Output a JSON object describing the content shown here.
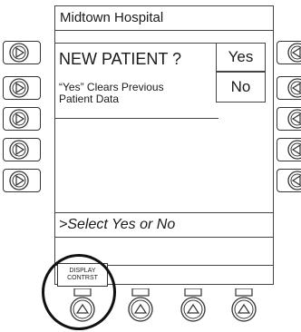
{
  "header": {
    "hospital": "Midtown Hospital"
  },
  "dialog": {
    "title": "NEW PATIENT ?",
    "message": "“Yes” Clears Previous Patient Data",
    "yes_label": "Yes",
    "no_label": "No"
  },
  "prompt": ">Select Yes or No",
  "softkeys": {
    "display_contrast_label_line1": "DISPLAY",
    "display_contrast_label_line2": "CONTRST"
  }
}
